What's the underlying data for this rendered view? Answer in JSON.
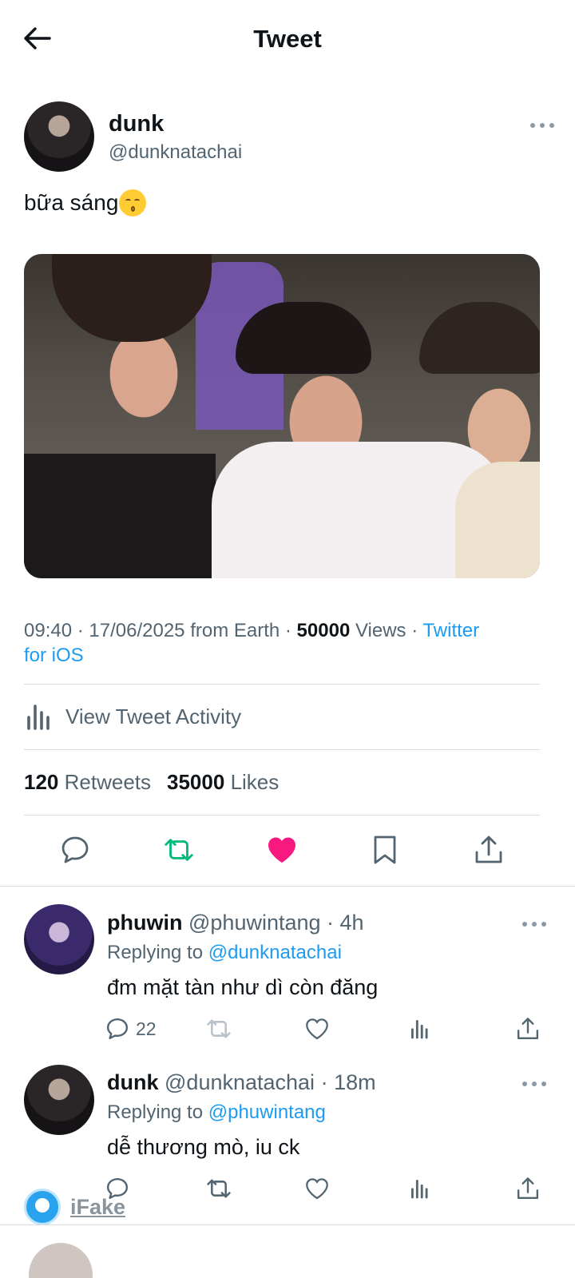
{
  "header": {
    "title": "Tweet"
  },
  "tweet": {
    "author_name": "dunk",
    "author_handle": "@dunknatachai",
    "text": "bữa sáng",
    "emoji": "kissing-face",
    "meta": {
      "time": "09:40",
      "date": "17/06/2025",
      "location": "from Earth",
      "views_count": "50000",
      "views_label": "Views",
      "client_line1": "Twitter",
      "client_line2": "for iOS"
    },
    "activity_label": "View Tweet Activity",
    "retweets_count": "120",
    "retweets_label": "Retweets",
    "likes_count": "35000",
    "likes_label": "Likes",
    "liked": true,
    "colors": {
      "accent": "#1d9bf0",
      "retweet": "#00ba7c",
      "like": "#f91880"
    }
  },
  "replies": [
    {
      "name": "phuwin",
      "handle": "@phuwintang",
      "time": "· 4h",
      "replying_label": "Replying to",
      "replying_to": "@dunknatachai",
      "text": "đm mặt tàn như dì còn đăng",
      "reply_count": "22"
    },
    {
      "name": "dunk",
      "handle": "@dunknatachai",
      "time": "· 18m",
      "replying_label": "Replying to",
      "replying_to": "@phuwintang",
      "text": "dễ thương mò, iu ck",
      "reply_count": ""
    }
  ],
  "watermark": {
    "text": "iFake"
  }
}
